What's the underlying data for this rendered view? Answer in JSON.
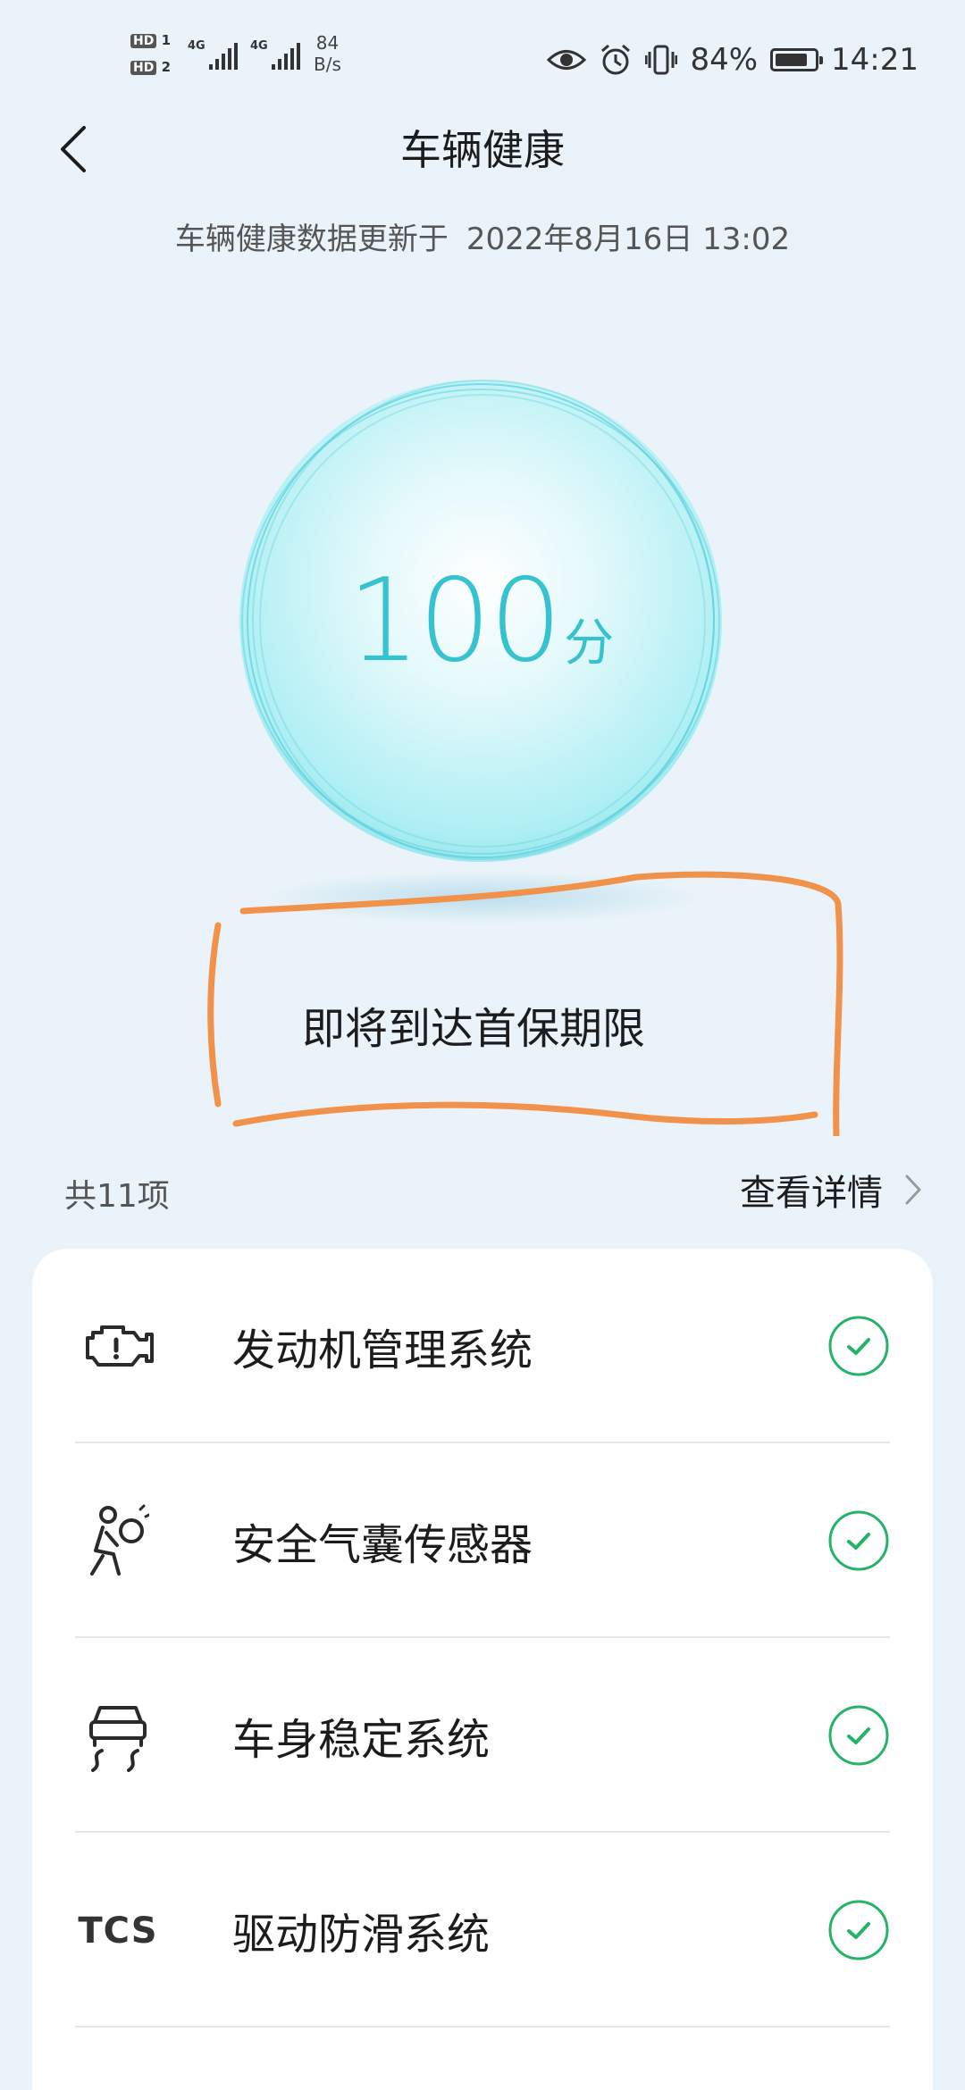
{
  "status_bar": {
    "sim1": "HD",
    "sim1_index": "1",
    "sim2": "HD",
    "sim2_index": "2",
    "network1": "4G",
    "network2": "4G",
    "net_speed_value": "84",
    "net_speed_unit": "B/s",
    "battery_percent": "84%",
    "battery_level": 0.84,
    "time": "14:21"
  },
  "header": {
    "title": "车辆健康"
  },
  "update": {
    "prefix": "车辆健康数据更新于",
    "datetime": "2022年8月16日 13:02"
  },
  "score": {
    "value": "100",
    "unit": "分"
  },
  "alert": {
    "message": "即将到达首保期限"
  },
  "summary": {
    "count_label": "共11项",
    "details_label": "查看详情"
  },
  "items": [
    {
      "label": "发动机管理系统",
      "icon": "engine-warning-icon",
      "status": "ok"
    },
    {
      "label": "安全气囊传感器",
      "icon": "airbag-icon",
      "status": "ok"
    },
    {
      "label": "车身稳定系统",
      "icon": "stability-control-icon",
      "status": "ok"
    },
    {
      "label": "驱动防滑系统",
      "icon_text": "TCS",
      "icon": "tcs-icon",
      "status": "ok"
    }
  ],
  "colors": {
    "accent": "#36c3cf",
    "check_green": "#25b36a",
    "annotation_orange": "#f0924a",
    "background": "#eaf3f9"
  }
}
